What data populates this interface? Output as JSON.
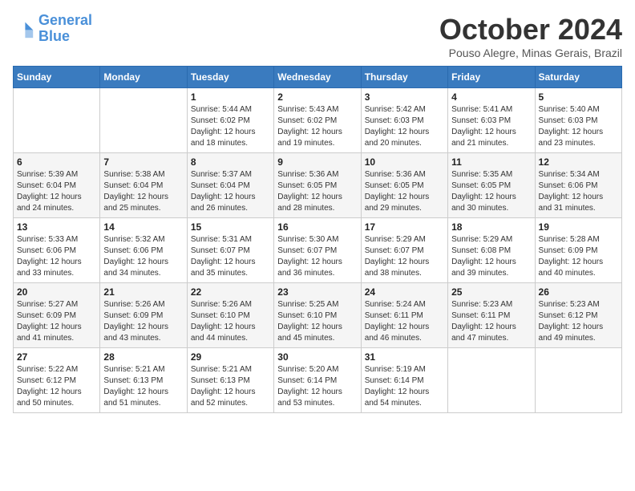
{
  "logo": {
    "line1": "General",
    "line2": "Blue"
  },
  "title": "October 2024",
  "subtitle": "Pouso Alegre, Minas Gerais, Brazil",
  "days_of_week": [
    "Sunday",
    "Monday",
    "Tuesday",
    "Wednesday",
    "Thursday",
    "Friday",
    "Saturday"
  ],
  "weeks": [
    [
      {
        "day": "",
        "info": ""
      },
      {
        "day": "",
        "info": ""
      },
      {
        "day": "1",
        "info": "Sunrise: 5:44 AM\nSunset: 6:02 PM\nDaylight: 12 hours and 18 minutes."
      },
      {
        "day": "2",
        "info": "Sunrise: 5:43 AM\nSunset: 6:02 PM\nDaylight: 12 hours and 19 minutes."
      },
      {
        "day": "3",
        "info": "Sunrise: 5:42 AM\nSunset: 6:03 PM\nDaylight: 12 hours and 20 minutes."
      },
      {
        "day": "4",
        "info": "Sunrise: 5:41 AM\nSunset: 6:03 PM\nDaylight: 12 hours and 21 minutes."
      },
      {
        "day": "5",
        "info": "Sunrise: 5:40 AM\nSunset: 6:03 PM\nDaylight: 12 hours and 23 minutes."
      }
    ],
    [
      {
        "day": "6",
        "info": "Sunrise: 5:39 AM\nSunset: 6:04 PM\nDaylight: 12 hours and 24 minutes."
      },
      {
        "day": "7",
        "info": "Sunrise: 5:38 AM\nSunset: 6:04 PM\nDaylight: 12 hours and 25 minutes."
      },
      {
        "day": "8",
        "info": "Sunrise: 5:37 AM\nSunset: 6:04 PM\nDaylight: 12 hours and 26 minutes."
      },
      {
        "day": "9",
        "info": "Sunrise: 5:36 AM\nSunset: 6:05 PM\nDaylight: 12 hours and 28 minutes."
      },
      {
        "day": "10",
        "info": "Sunrise: 5:36 AM\nSunset: 6:05 PM\nDaylight: 12 hours and 29 minutes."
      },
      {
        "day": "11",
        "info": "Sunrise: 5:35 AM\nSunset: 6:05 PM\nDaylight: 12 hours and 30 minutes."
      },
      {
        "day": "12",
        "info": "Sunrise: 5:34 AM\nSunset: 6:06 PM\nDaylight: 12 hours and 31 minutes."
      }
    ],
    [
      {
        "day": "13",
        "info": "Sunrise: 5:33 AM\nSunset: 6:06 PM\nDaylight: 12 hours and 33 minutes."
      },
      {
        "day": "14",
        "info": "Sunrise: 5:32 AM\nSunset: 6:06 PM\nDaylight: 12 hours and 34 minutes."
      },
      {
        "day": "15",
        "info": "Sunrise: 5:31 AM\nSunset: 6:07 PM\nDaylight: 12 hours and 35 minutes."
      },
      {
        "day": "16",
        "info": "Sunrise: 5:30 AM\nSunset: 6:07 PM\nDaylight: 12 hours and 36 minutes."
      },
      {
        "day": "17",
        "info": "Sunrise: 5:29 AM\nSunset: 6:07 PM\nDaylight: 12 hours and 38 minutes."
      },
      {
        "day": "18",
        "info": "Sunrise: 5:29 AM\nSunset: 6:08 PM\nDaylight: 12 hours and 39 minutes."
      },
      {
        "day": "19",
        "info": "Sunrise: 5:28 AM\nSunset: 6:09 PM\nDaylight: 12 hours and 40 minutes."
      }
    ],
    [
      {
        "day": "20",
        "info": "Sunrise: 5:27 AM\nSunset: 6:09 PM\nDaylight: 12 hours and 41 minutes."
      },
      {
        "day": "21",
        "info": "Sunrise: 5:26 AM\nSunset: 6:09 PM\nDaylight: 12 hours and 43 minutes."
      },
      {
        "day": "22",
        "info": "Sunrise: 5:26 AM\nSunset: 6:10 PM\nDaylight: 12 hours and 44 minutes."
      },
      {
        "day": "23",
        "info": "Sunrise: 5:25 AM\nSunset: 6:10 PM\nDaylight: 12 hours and 45 minutes."
      },
      {
        "day": "24",
        "info": "Sunrise: 5:24 AM\nSunset: 6:11 PM\nDaylight: 12 hours and 46 minutes."
      },
      {
        "day": "25",
        "info": "Sunrise: 5:23 AM\nSunset: 6:11 PM\nDaylight: 12 hours and 47 minutes."
      },
      {
        "day": "26",
        "info": "Sunrise: 5:23 AM\nSunset: 6:12 PM\nDaylight: 12 hours and 49 minutes."
      }
    ],
    [
      {
        "day": "27",
        "info": "Sunrise: 5:22 AM\nSunset: 6:12 PM\nDaylight: 12 hours and 50 minutes."
      },
      {
        "day": "28",
        "info": "Sunrise: 5:21 AM\nSunset: 6:13 PM\nDaylight: 12 hours and 51 minutes."
      },
      {
        "day": "29",
        "info": "Sunrise: 5:21 AM\nSunset: 6:13 PM\nDaylight: 12 hours and 52 minutes."
      },
      {
        "day": "30",
        "info": "Sunrise: 5:20 AM\nSunset: 6:14 PM\nDaylight: 12 hours and 53 minutes."
      },
      {
        "day": "31",
        "info": "Sunrise: 5:19 AM\nSunset: 6:14 PM\nDaylight: 12 hours and 54 minutes."
      },
      {
        "day": "",
        "info": ""
      },
      {
        "day": "",
        "info": ""
      }
    ]
  ]
}
